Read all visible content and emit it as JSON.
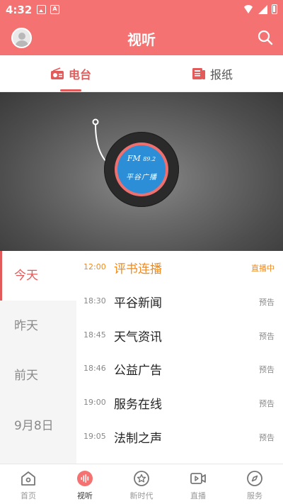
{
  "status_bar": {
    "time": "4:32",
    "notif_icon_2_text": "A"
  },
  "header": {
    "title": "视听"
  },
  "tabs": [
    {
      "label": "电台",
      "icon": "radio-icon",
      "active": true
    },
    {
      "label": "报纸",
      "icon": "newspaper-icon",
      "active": false
    }
  ],
  "banner": {
    "fm_label": "FM",
    "frequency": "89.2",
    "station": "平谷广播"
  },
  "days": [
    {
      "label": "今天",
      "active": true
    },
    {
      "label": "昨天",
      "active": false
    },
    {
      "label": "前天",
      "active": false
    },
    {
      "label": "9月8日",
      "active": false
    }
  ],
  "programs": [
    {
      "time": "12:00",
      "title": "评书连播",
      "status": "直播中",
      "live": true
    },
    {
      "time": "18:30",
      "title": "平谷新闻",
      "status": "预告",
      "live": false
    },
    {
      "time": "18:45",
      "title": "天气资讯",
      "status": "预告",
      "live": false
    },
    {
      "time": "18:46",
      "title": "公益广告",
      "status": "预告",
      "live": false
    },
    {
      "time": "19:00",
      "title": "服务在线",
      "status": "预告",
      "live": false
    },
    {
      "time": "19:05",
      "title": "法制之声",
      "status": "预告",
      "live": false
    }
  ],
  "bottom_nav": [
    {
      "label": "首页",
      "icon": "home-icon",
      "active": false
    },
    {
      "label": "视听",
      "icon": "audio-wave-icon",
      "active": true
    },
    {
      "label": "新时代",
      "icon": "star-badge-icon",
      "active": false
    },
    {
      "label": "直播",
      "icon": "video-icon",
      "active": false
    },
    {
      "label": "服务",
      "icon": "compass-icon",
      "active": false
    }
  ],
  "colors": {
    "brand": "#f47271",
    "accent": "#e35a5a",
    "live": "#f08a1c",
    "disc": "#2b8ed6"
  }
}
